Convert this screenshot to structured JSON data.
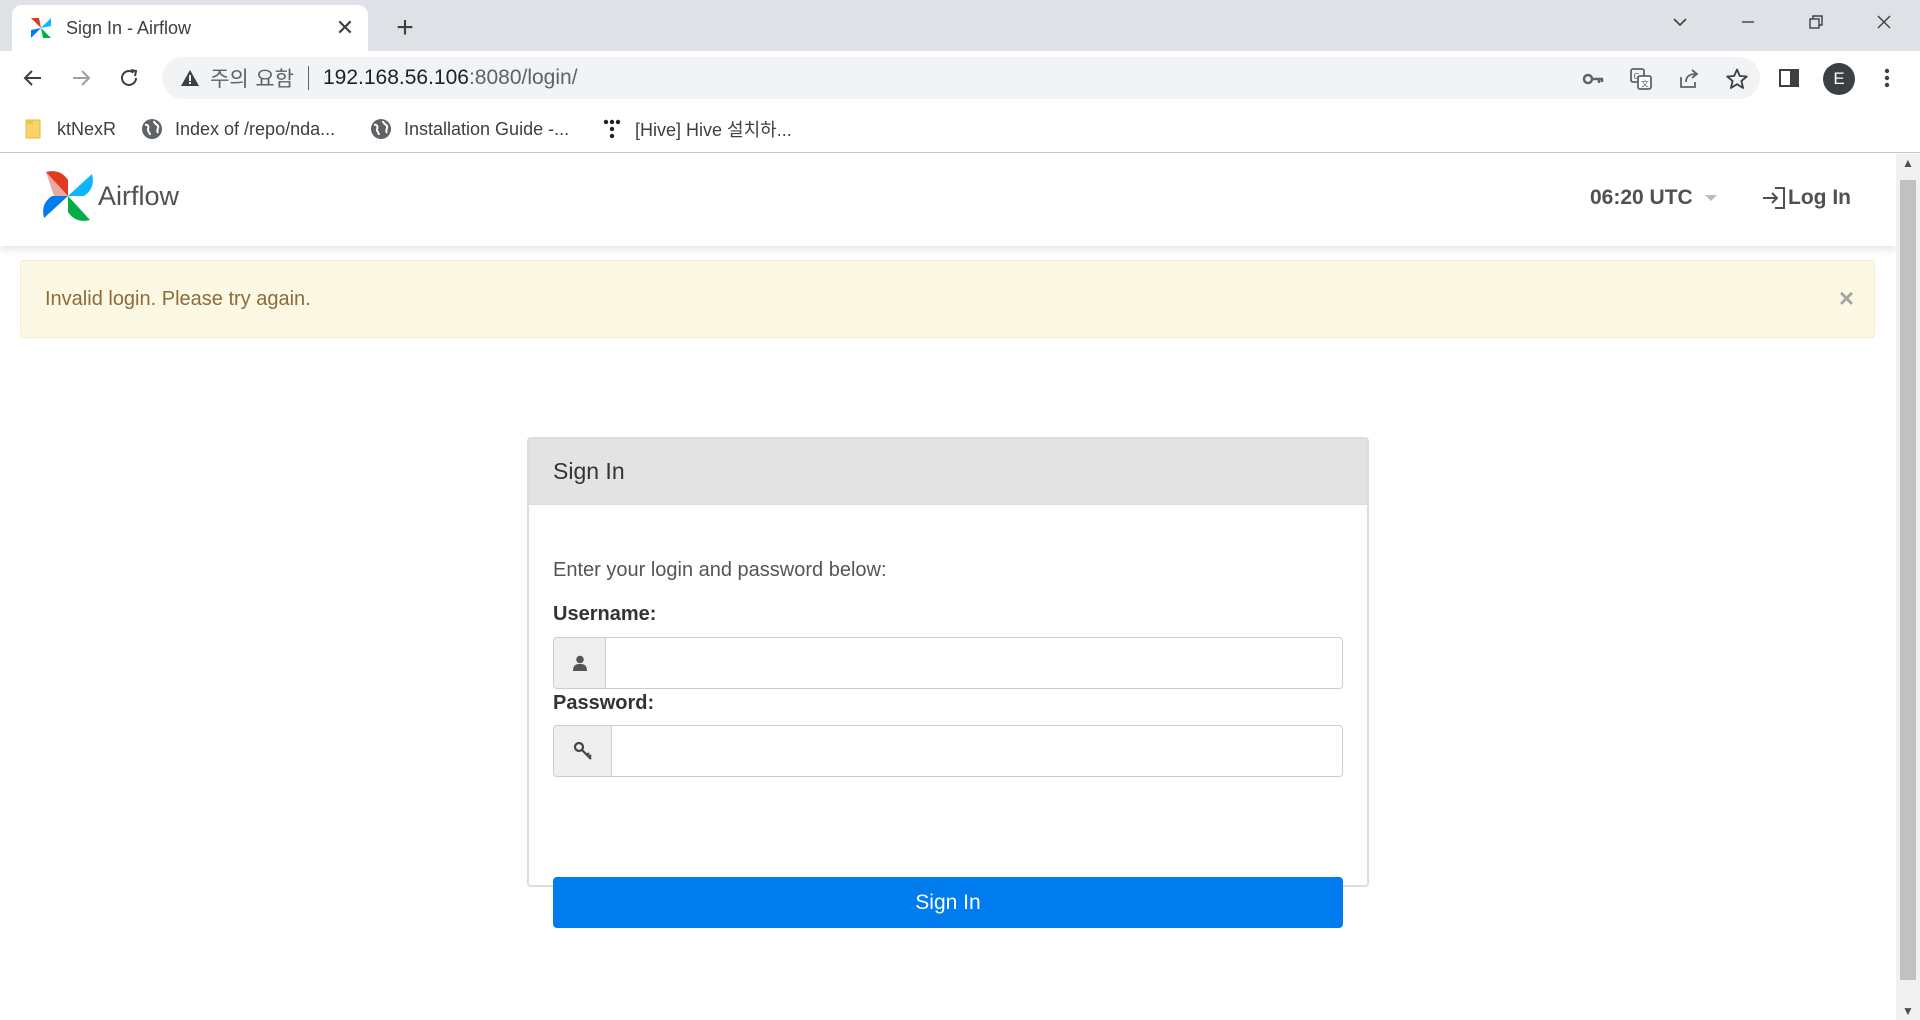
{
  "browser": {
    "tab_title": "Sign In - Airflow",
    "omnibox": {
      "security_label": "주의 요함",
      "url_host": "192.168.56.106",
      "url_rest": ":8080/login/"
    },
    "profile_initial": "E",
    "bookmarks": [
      {
        "label": "ktNexR",
        "icon": "folder-icon"
      },
      {
        "label": "Index of /repo/nda...",
        "icon": "globe-icon"
      },
      {
        "label": "Installation Guide -...",
        "icon": "globe-icon"
      },
      {
        "label": "[Hive] Hive 설치하...",
        "icon": "dots-icon"
      }
    ]
  },
  "navbar": {
    "brand": "Airflow",
    "clock": "06:20 UTC",
    "login_label": "Log In"
  },
  "alert": {
    "message": "Invalid login. Please try again.",
    "close_glyph": "×"
  },
  "login_panel": {
    "title": "Sign In",
    "intro": "Enter your login and password below:",
    "username_label": "Username:",
    "username_value": "",
    "password_label": "Password:",
    "password_value": "",
    "submit_label": "Sign In"
  },
  "colors": {
    "primary_button": "#017cee",
    "alert_bg": "#fcf8e3",
    "alert_text": "#8a6d3b"
  }
}
